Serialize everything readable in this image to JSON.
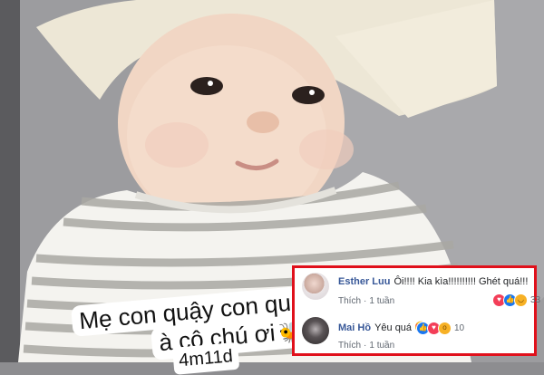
{
  "story": {
    "caption_line1": "Mẹ con quậy con quài",
    "caption_line2": "à cô chú ơi",
    "caption_line3": "4m11d"
  },
  "comments": [
    {
      "author": "Esther Luu",
      "text": "Ôi!!!! Kia kìa!!!!!!!!!! Ghét quá!!!",
      "like_label": "Thích",
      "time": "1 tuần",
      "reactions": [
        "love-reaction",
        "like-reaction",
        "haha-reaction"
      ],
      "reaction_count": "33"
    },
    {
      "author": "Mai Hồ",
      "text": "Yêu quá",
      "emoji": "heart-eyes",
      "like_label": "Thích",
      "time": "1 tuần",
      "reactions": [
        "like-reaction",
        "love-reaction",
        "wow-reaction"
      ],
      "reaction_count": "10"
    }
  ],
  "colors": {
    "highlight_border": "#e0101b",
    "author_name": "#385898",
    "like_blue": "#1877f2",
    "love_red": "#f33e58"
  }
}
